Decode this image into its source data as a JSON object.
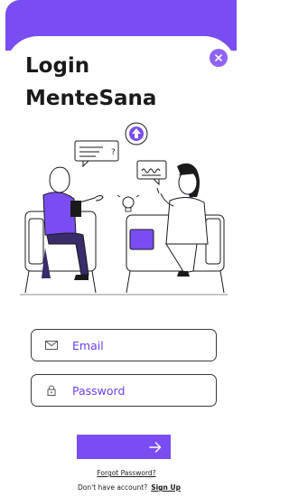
{
  "colors": {
    "accent": "#7a4df3",
    "accent_light": "#8f63f7",
    "text": "#1a1a1a",
    "field_text": "#6b3df0"
  },
  "header": {
    "title_line1": "Login",
    "title_line2": "MenteSana",
    "close_icon": "close-icon"
  },
  "illustration": {
    "bubble_left_text": "?"
  },
  "form": {
    "email": {
      "icon": "envelope-icon",
      "placeholder": "Email",
      "value": ""
    },
    "password": {
      "icon": "lock-icon",
      "placeholder": "Password",
      "value": ""
    },
    "submit_icon": "arrow-right-icon"
  },
  "footer": {
    "forgot_password": "Forgot Password?",
    "no_account": "Don't have account?",
    "sign_up": "Sign Up"
  }
}
